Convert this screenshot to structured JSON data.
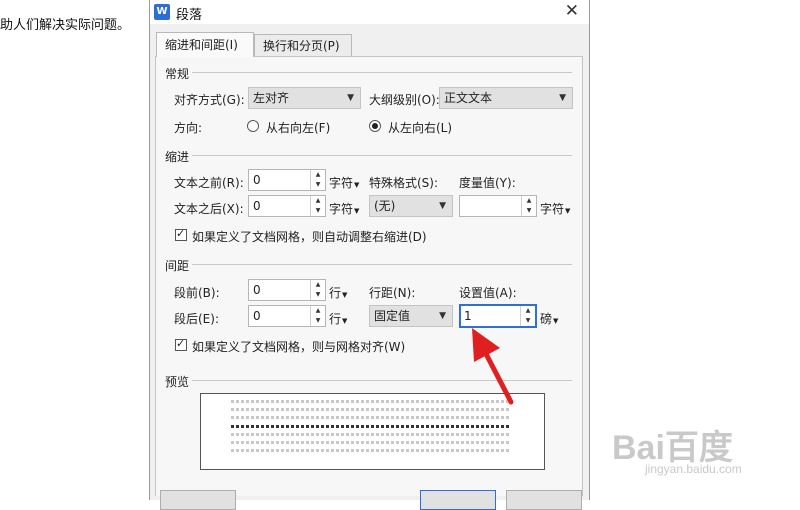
{
  "document": {
    "text": "助人们解决实际问题。"
  },
  "dialog": {
    "title": "段落",
    "app_icon": "W",
    "close_glyph": "✕",
    "tabs": [
      {
        "label": "缩进和间距(I)",
        "active": true
      },
      {
        "label": "换行和分页(P)",
        "active": false
      }
    ],
    "general": {
      "title": "常规",
      "alignment_label": "对齐方式(G):",
      "alignment_value": "左对齐",
      "outline_label": "大纲级别(O):",
      "outline_value": "正文文本",
      "direction_label": "方向:",
      "rtl_label": "从右向左(F)",
      "ltr_label": "从左向右(L)",
      "ltr_checked": true
    },
    "indent": {
      "title": "缩进",
      "before_label": "文本之前(R):",
      "before_value": "0",
      "before_unit": "字符",
      "after_label": "文本之后(X):",
      "after_value": "0",
      "after_unit": "字符",
      "special_label": "特殊格式(S):",
      "special_value": "(无)",
      "measure_label": "度量值(Y):",
      "measure_value": "",
      "measure_unit": "字符",
      "auto_adjust_label": "如果定义了文档网格，则自动调整右缩进(D)",
      "auto_adjust_checked": true
    },
    "spacing": {
      "title": "间距",
      "before_label": "段前(B):",
      "before_value": "0",
      "before_unit": "行",
      "after_label": "段后(E):",
      "after_value": "0",
      "after_unit": "行",
      "line_spacing_label": "行距(N):",
      "line_spacing_value": "固定值",
      "setting_label": "设置值(A):",
      "setting_value": "1",
      "setting_unit": "磅",
      "snap_grid_label": "如果定义了文档网格，则与网格对齐(W)",
      "snap_grid_checked": true
    },
    "preview": {
      "title": "预览"
    }
  },
  "watermark": {
    "text": "Bai百度",
    "sub": "jingyan.baidu.com"
  },
  "annotation": {
    "arrow_color": "#e02020"
  }
}
